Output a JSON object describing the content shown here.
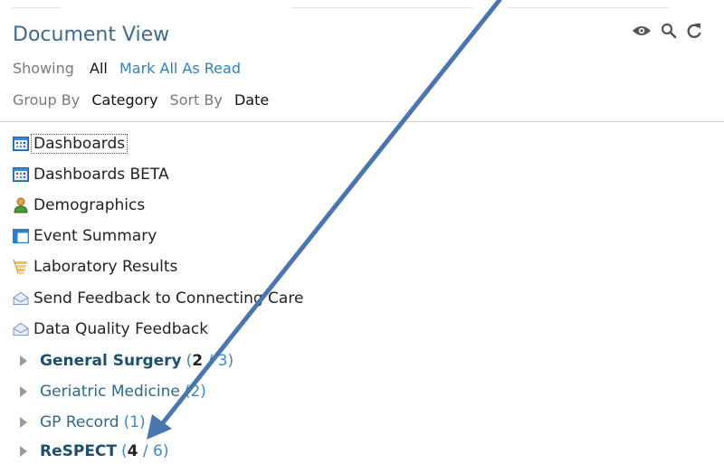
{
  "header": {
    "title": "Document View",
    "showing_label": "Showing",
    "showing_value": "All",
    "mark_all_read": "Mark All As Read",
    "group_by_label": "Group By",
    "group_by_value": "Category",
    "sort_by_label": "Sort By",
    "sort_by_value": "Date"
  },
  "toolbar": {
    "icons": [
      "eye-icon",
      "search-icon",
      "refresh-icon"
    ]
  },
  "items": [
    {
      "label": "Dashboards",
      "icon": "dashboard-icon",
      "selected": true
    },
    {
      "label": "Dashboards BETA",
      "icon": "dashboard-icon"
    },
    {
      "label": "Demographics",
      "icon": "person-icon"
    },
    {
      "label": "Event Summary",
      "icon": "table-icon"
    },
    {
      "label": "Laboratory Results",
      "icon": "lab-results-icon"
    },
    {
      "label": "Send Feedback to Connecting Care",
      "icon": "envelope-icon"
    },
    {
      "label": "Data Quality Feedback",
      "icon": "envelope-icon"
    }
  ],
  "groups": [
    {
      "label": "General Surgery",
      "count_open": "(",
      "count_unread": "2",
      "count_total": " / 3)",
      "bold": true
    },
    {
      "label": "Geriatric Medicine",
      "count": "(2)",
      "bold": false
    },
    {
      "label": "GP Record",
      "count": "(1)",
      "bold": false
    },
    {
      "label": "ReSPECT",
      "count_open": "(",
      "count_unread": "4",
      "count_total": " / 6)",
      "bold": true
    }
  ],
  "annotation": {
    "arrow_color": "#4a76b0"
  }
}
